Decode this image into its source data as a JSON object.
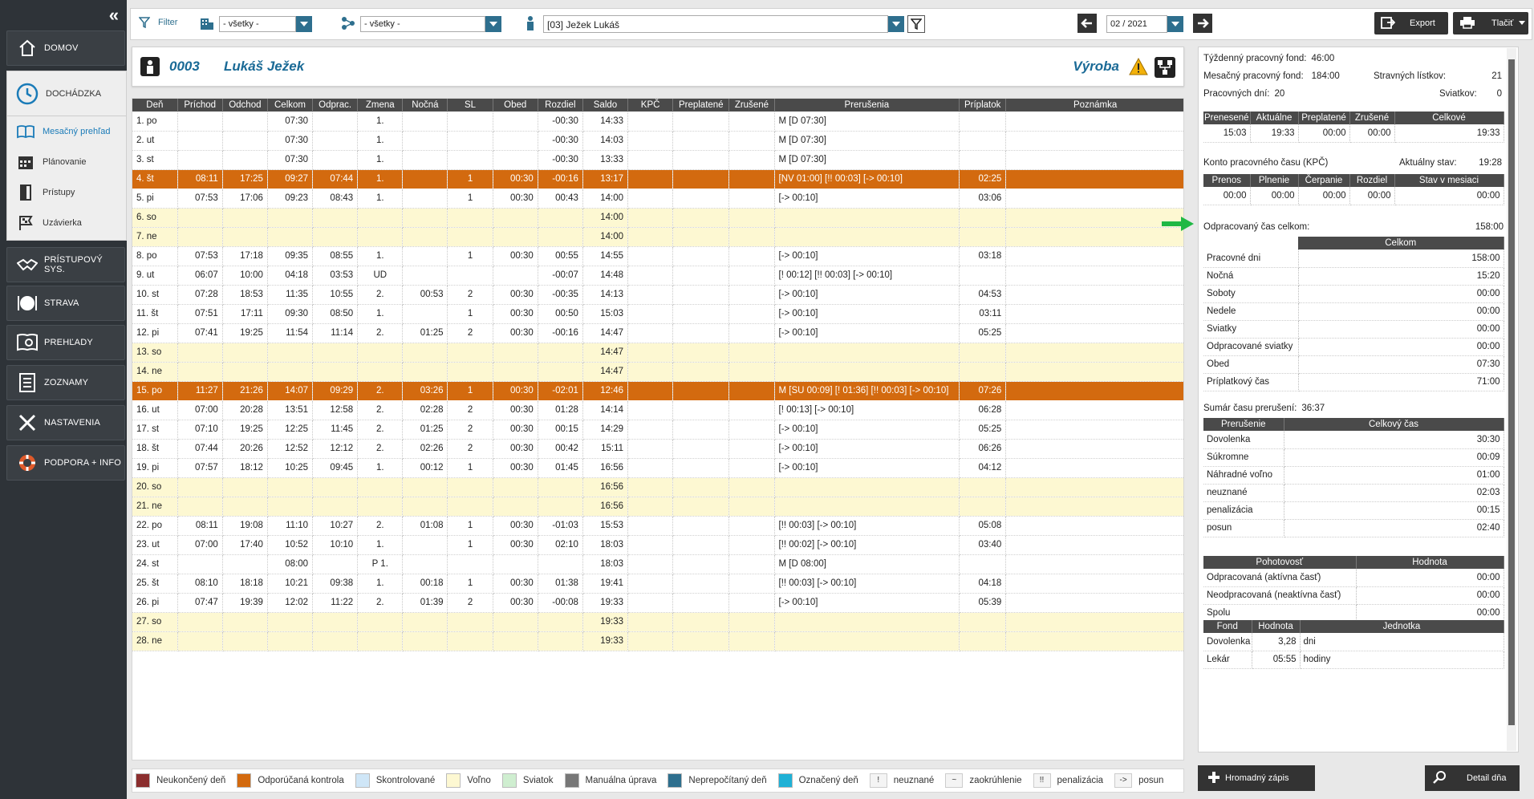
{
  "sidebar": {
    "items": [
      {
        "label": "DOMOV",
        "icon": "home-icon"
      },
      {
        "label": "DOCHÁDZKA",
        "icon": "clock-icon"
      },
      {
        "label": "PRÍSTUPOVÝ SYS.",
        "icon": "handshake-icon"
      },
      {
        "label": "STRAVA",
        "icon": "plate-icon"
      },
      {
        "label": "PREHĽADY",
        "icon": "report-icon"
      },
      {
        "label": "ZOZNAMY",
        "icon": "list-icon"
      },
      {
        "label": "NASTAVENIA",
        "icon": "tools-icon"
      },
      {
        "label": "PODPORA + INFO",
        "icon": "lifebuoy-icon"
      }
    ],
    "sub": [
      {
        "label": "Mesačný prehľad",
        "icon": "book-icon"
      },
      {
        "label": "Plánovanie",
        "icon": "calendar-icon"
      },
      {
        "label": "Prístupy",
        "icon": "door-icon"
      },
      {
        "label": "Uzávierka",
        "icon": "flag-icon"
      }
    ]
  },
  "toolbar": {
    "filter_label": "Filter",
    "dept_value": "- všetky -",
    "group_value": "- všetky -",
    "employee_value": "[03] Ježek Lukáš",
    "month_value": "02 / 2021",
    "export_label": "Export",
    "print_label": "Tlačiť"
  },
  "employee": {
    "code": "0003",
    "name": "Lukáš Ježek",
    "dept": "Výroba"
  },
  "table": {
    "headers": [
      "Deň",
      "Príchod",
      "Odchod",
      "Celkom",
      "Odprac.",
      "Zmena",
      "Nočná",
      "SL",
      "Obed",
      "Rozdiel",
      "Saldo",
      "KPČ",
      "Preplatené",
      "Zrušené",
      "Prerušenia",
      "Príplatok",
      "Poznámka"
    ],
    "rows": [
      {
        "type": "normal",
        "cells": [
          "1. po",
          "",
          "",
          "07:30",
          "",
          "1.",
          "",
          "",
          "",
          "-00:30",
          "14:33",
          "",
          "",
          "",
          "M [D 07:30]",
          "",
          ""
        ]
      },
      {
        "type": "normal",
        "cells": [
          "2. ut",
          "",
          "",
          "07:30",
          "",
          "1.",
          "",
          "",
          "",
          "-00:30",
          "14:03",
          "",
          "",
          "",
          "M [D 07:30]",
          "",
          ""
        ]
      },
      {
        "type": "normal",
        "cells": [
          "3. st",
          "",
          "",
          "07:30",
          "",
          "1.",
          "",
          "",
          "",
          "-00:30",
          "13:33",
          "",
          "",
          "",
          "M [D 07:30]",
          "",
          ""
        ]
      },
      {
        "type": "warn",
        "cells": [
          "4. št",
          "08:11",
          "17:25",
          "09:27",
          "07:44",
          "1.",
          "",
          "1",
          "00:30",
          "-00:16",
          "13:17",
          "",
          "",
          "",
          "[NV 01:00] [!! 00:03] [-> 00:10]",
          "02:25",
          ""
        ]
      },
      {
        "type": "normal",
        "cells": [
          "5. pi",
          "07:53",
          "17:06",
          "09:23",
          "08:43",
          "1.",
          "",
          "1",
          "00:30",
          "00:43",
          "14:00",
          "",
          "",
          "",
          "[-> 00:10]",
          "03:06",
          ""
        ]
      },
      {
        "type": "free",
        "cells": [
          "6. so",
          "",
          "",
          "",
          "",
          "",
          "",
          "",
          "",
          "",
          "14:00",
          "",
          "",
          "",
          "",
          "",
          ""
        ]
      },
      {
        "type": "free",
        "cells": [
          "7. ne",
          "",
          "",
          "",
          "",
          "",
          "",
          "",
          "",
          "",
          "14:00",
          "",
          "",
          "",
          "",
          "",
          ""
        ]
      },
      {
        "type": "normal",
        "cells": [
          "8. po",
          "07:53",
          "17:18",
          "09:35",
          "08:55",
          "1.",
          "",
          "1",
          "00:30",
          "00:55",
          "14:55",
          "",
          "",
          "",
          "[-> 00:10]",
          "03:18",
          ""
        ]
      },
      {
        "type": "normal",
        "cells": [
          "9. ut",
          "06:07",
          "10:00",
          "04:18",
          "03:53",
          "UD",
          "",
          "",
          "",
          "-00:07",
          "14:48",
          "",
          "",
          "",
          "[! 00:12] [!! 00:03] [-> 00:10]",
          "",
          ""
        ]
      },
      {
        "type": "normal",
        "cells": [
          "10. st",
          "07:28",
          "18:53",
          "11:35",
          "10:55",
          "2.",
          "00:53",
          "2",
          "00:30",
          "-00:35",
          "14:13",
          "",
          "",
          "",
          "[-> 00:10]",
          "04:53",
          ""
        ]
      },
      {
        "type": "normal",
        "cells": [
          "11. št",
          "07:51",
          "17:11",
          "09:30",
          "08:50",
          "1.",
          "",
          "1",
          "00:30",
          "00:50",
          "15:03",
          "",
          "",
          "",
          "[-> 00:10]",
          "03:11",
          ""
        ]
      },
      {
        "type": "normal",
        "cells": [
          "12. pi",
          "07:41",
          "19:25",
          "11:54",
          "11:14",
          "2.",
          "01:25",
          "2",
          "00:30",
          "-00:16",
          "14:47",
          "",
          "",
          "",
          "[-> 00:10]",
          "05:25",
          ""
        ]
      },
      {
        "type": "free",
        "cells": [
          "13. so",
          "",
          "",
          "",
          "",
          "",
          "",
          "",
          "",
          "",
          "14:47",
          "",
          "",
          "",
          "",
          "",
          ""
        ]
      },
      {
        "type": "free",
        "cells": [
          "14. ne",
          "",
          "",
          "",
          "",
          "",
          "",
          "",
          "",
          "",
          "14:47",
          "",
          "",
          "",
          "",
          "",
          ""
        ]
      },
      {
        "type": "warn",
        "cells": [
          "15. po",
          "11:27",
          "21:26",
          "14:07",
          "09:29",
          "2.",
          "03:26",
          "1",
          "00:30",
          "-02:01",
          "12:46",
          "",
          "",
          "",
          "M [SU 00:09] [! 01:36] [!! 00:03] [-> 00:10]",
          "07:26",
          ""
        ]
      },
      {
        "type": "normal",
        "cells": [
          "16. ut",
          "07:00",
          "20:28",
          "13:51",
          "12:58",
          "2.",
          "02:28",
          "2",
          "00:30",
          "01:28",
          "14:14",
          "",
          "",
          "",
          "[! 00:13] [-> 00:10]",
          "06:28",
          ""
        ]
      },
      {
        "type": "normal",
        "cells": [
          "17. st",
          "07:10",
          "19:25",
          "12:25",
          "11:45",
          "2.",
          "01:25",
          "2",
          "00:30",
          "00:15",
          "14:29",
          "",
          "",
          "",
          "[-> 00:10]",
          "05:25",
          ""
        ]
      },
      {
        "type": "normal",
        "cells": [
          "18. št",
          "07:44",
          "20:26",
          "12:52",
          "12:12",
          "2.",
          "02:26",
          "2",
          "00:30",
          "00:42",
          "15:11",
          "",
          "",
          "",
          "[-> 00:10]",
          "06:26",
          ""
        ]
      },
      {
        "type": "normal",
        "cells": [
          "19. pi",
          "07:57",
          "18:12",
          "10:25",
          "09:45",
          "1.",
          "00:12",
          "1",
          "00:30",
          "01:45",
          "16:56",
          "",
          "",
          "",
          "[-> 00:10]",
          "04:12",
          ""
        ]
      },
      {
        "type": "free",
        "cells": [
          "20. so",
          "",
          "",
          "",
          "",
          "",
          "",
          "",
          "",
          "",
          "16:56",
          "",
          "",
          "",
          "",
          "",
          ""
        ]
      },
      {
        "type": "free",
        "cells": [
          "21. ne",
          "",
          "",
          "",
          "",
          "",
          "",
          "",
          "",
          "",
          "16:56",
          "",
          "",
          "",
          "",
          "",
          ""
        ]
      },
      {
        "type": "normal",
        "cells": [
          "22. po",
          "08:11",
          "19:08",
          "11:10",
          "10:27",
          "2.",
          "01:08",
          "1",
          "00:30",
          "-01:03",
          "15:53",
          "",
          "",
          "",
          "[!! 00:03] [-> 00:10]",
          "05:08",
          ""
        ]
      },
      {
        "type": "normal",
        "cells": [
          "23. ut",
          "07:00",
          "17:40",
          "10:52",
          "10:10",
          "1.",
          "",
          "1",
          "00:30",
          "02:10",
          "18:03",
          "",
          "",
          "",
          "[!! 00:02] [-> 00:10]",
          "03:40",
          ""
        ]
      },
      {
        "type": "normal",
        "cells": [
          "24. st",
          "",
          "",
          "08:00",
          "",
          "P 1.",
          "",
          "",
          "",
          "",
          "18:03",
          "",
          "",
          "",
          "M [D 08:00]",
          "",
          ""
        ]
      },
      {
        "type": "normal",
        "cells": [
          "25. št",
          "08:10",
          "18:18",
          "10:21",
          "09:38",
          "1.",
          "00:18",
          "1",
          "00:30",
          "01:38",
          "19:41",
          "",
          "",
          "",
          "[!! 00:03] [-> 00:10]",
          "04:18",
          ""
        ]
      },
      {
        "type": "normal",
        "cells": [
          "26. pi",
          "07:47",
          "19:39",
          "12:02",
          "11:22",
          "2.",
          "01:39",
          "2",
          "00:30",
          "-00:08",
          "19:33",
          "",
          "",
          "",
          "[-> 00:10]",
          "05:39",
          ""
        ]
      },
      {
        "type": "free",
        "cells": [
          "27. so",
          "",
          "",
          "",
          "",
          "",
          "",
          "",
          "",
          "",
          "19:33",
          "",
          "",
          "",
          "",
          "",
          ""
        ]
      },
      {
        "type": "free",
        "cells": [
          "28. ne",
          "",
          "",
          "",
          "",
          "",
          "",
          "",
          "",
          "",
          "19:33",
          "",
          "",
          "",
          "",
          "",
          ""
        ]
      }
    ]
  },
  "legend": {
    "colors": [
      {
        "label": "Neukončený deň",
        "color": "#8b2e2e"
      },
      {
        "label": "Odporúčaná kontrola",
        "color": "#d36a0f"
      },
      {
        "label": "Skontrolované",
        "color": "#cfe6f7"
      },
      {
        "label": "Voľno",
        "color": "#fdf8d2"
      },
      {
        "label": "Sviatok",
        "color": "#cfeed0"
      },
      {
        "label": "Manuálna úprava",
        "color": "#777777"
      },
      {
        "label": "Neprepočítaný deň",
        "color": "#2e6f8e"
      },
      {
        "label": "Označený deň",
        "color": "#1fb1d6"
      }
    ],
    "symbols": [
      {
        "sym": "!",
        "label": "neuznané"
      },
      {
        "sym": "~",
        "label": "zaokrúhlenie"
      },
      {
        "sym": "!!",
        "label": "penalizácia"
      },
      {
        "sym": "->",
        "label": "posun"
      }
    ]
  },
  "summary": {
    "weekly_fund_label": "Týždenný pracovný fond:",
    "weekly_fund": "46:00",
    "monthly_fund_label": "Mesačný pracovný fond:",
    "monthly_fund": "184:00",
    "meal_label": "Stravných lístkov:",
    "meal": "21",
    "workdays_label": "Pracovných dní:",
    "workdays": "20",
    "holidays_label": "Sviatkov:",
    "holidays": "0",
    "dov_headers": [
      "Prenesené",
      "Aktuálne",
      "Preplatené",
      "Zrušené",
      "Celkové"
    ],
    "dov_values": [
      "15:03",
      "19:33",
      "00:00",
      "00:00",
      "19:33"
    ],
    "kpc_title": "Konto pracovného času (KPČ)",
    "kpc_state_label": "Aktuálny stav:",
    "kpc_state": "19:28",
    "kpc_headers": [
      "Prenos",
      "Plnenie",
      "Čerpanie",
      "Rozdiel",
      "Stav v mesiaci"
    ],
    "kpc_values": [
      "00:00",
      "00:00",
      "00:00",
      "00:00",
      "00:00"
    ],
    "worked_label": "Odpracovaný čas celkom:",
    "worked": "158:00",
    "worked_header": "Celkom",
    "worked_rows": [
      {
        "k": "Pracovné dni",
        "v": "158:00"
      },
      {
        "k": "Nočná",
        "v": "15:20"
      },
      {
        "k": "Soboty",
        "v": "00:00"
      },
      {
        "k": "Nedele",
        "v": "00:00"
      },
      {
        "k": "Sviatky",
        "v": "00:00"
      },
      {
        "k": "Odpracované sviatky",
        "v": "00:00"
      },
      {
        "k": "Obed",
        "v": "07:30"
      },
      {
        "k": "Príplatkový čas",
        "v": "71:00"
      }
    ],
    "breaks_label": "Sumár času prerušení:",
    "breaks": "36:37",
    "breaks_headers": [
      "Prerušenie",
      "Celkový čas"
    ],
    "breaks_rows": [
      {
        "k": "Dovolenka",
        "v": "30:30"
      },
      {
        "k": "Súkromne",
        "v": "00:09"
      },
      {
        "k": "Náhradné voľno",
        "v": "01:00"
      },
      {
        "k": "neuznané",
        "v": "02:03"
      },
      {
        "k": "penalizácia",
        "v": "00:15"
      },
      {
        "k": "posun",
        "v": "02:40"
      }
    ],
    "pohot_headers": [
      "Pohotovosť",
      "Hodnota"
    ],
    "pohot_rows": [
      {
        "k": "Odpracovaná (aktívna časť)",
        "v": "00:00"
      },
      {
        "k": "Neodpracovaná (neaktívna časť)",
        "v": "00:00"
      },
      {
        "k": "Spolu",
        "v": "00:00"
      }
    ],
    "fond_headers": [
      "Fond",
      "Hodnota",
      "Jednotka"
    ],
    "fond_rows": [
      {
        "k": "Dovolenka",
        "v": "3,28",
        "u": "dni"
      },
      {
        "k": "Lekár",
        "v": "05:55",
        "u": "hodiny"
      }
    ]
  },
  "buttons": {
    "bulk_label": "Hromadný zápis",
    "detail_label": "Detail dňa"
  }
}
